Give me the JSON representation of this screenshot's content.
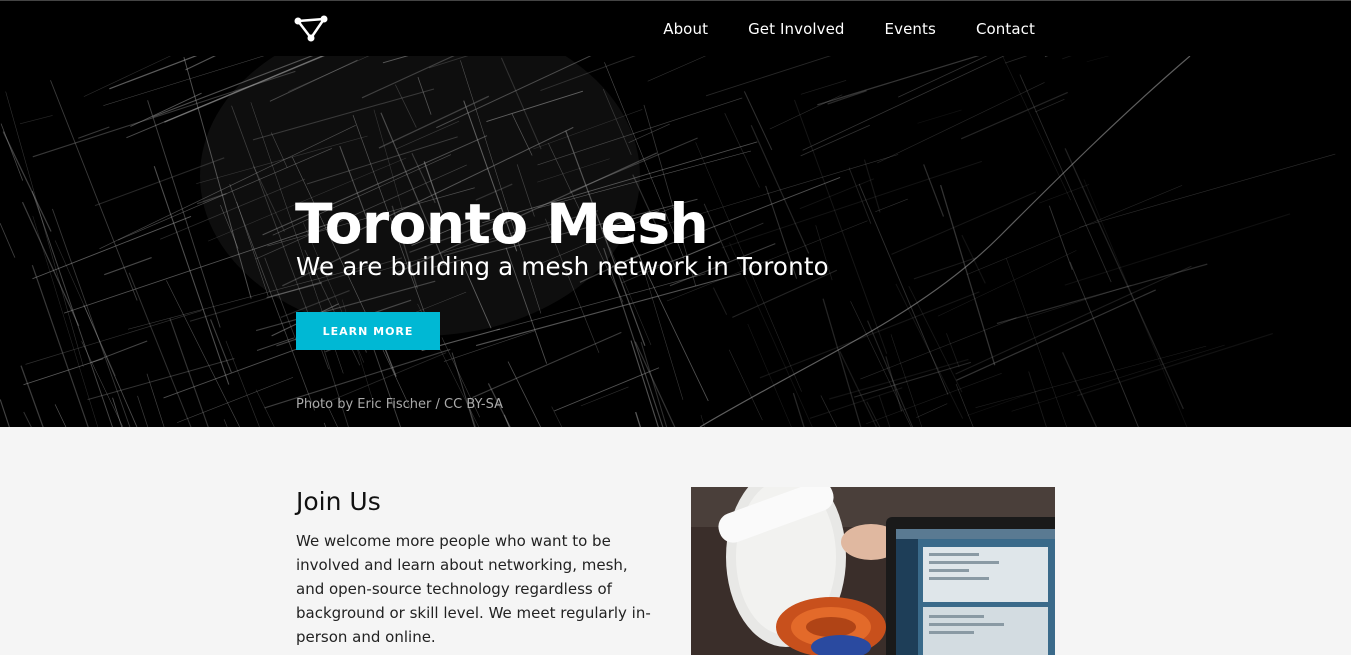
{
  "header": {
    "logo": "mesh-logo-icon",
    "nav": [
      {
        "label": "About"
      },
      {
        "label": "Get Involved"
      },
      {
        "label": "Events"
      },
      {
        "label": "Contact"
      }
    ]
  },
  "hero": {
    "title": "Toronto Mesh",
    "subtitle": "We are building a mesh network in Toronto",
    "cta_label": "LEARN MORE",
    "credit": "Photo by Eric Fischer / CC BY-SA"
  },
  "join": {
    "title": "Join Us",
    "text": "We welcome more people who want to be involved and learn about networking, mesh, and open-source technology regardless of background or skill level. We meet regularly in-person and online."
  },
  "colors": {
    "accent": "#00b8d4",
    "topbar": "#000000",
    "background": "#f5f5f5"
  }
}
